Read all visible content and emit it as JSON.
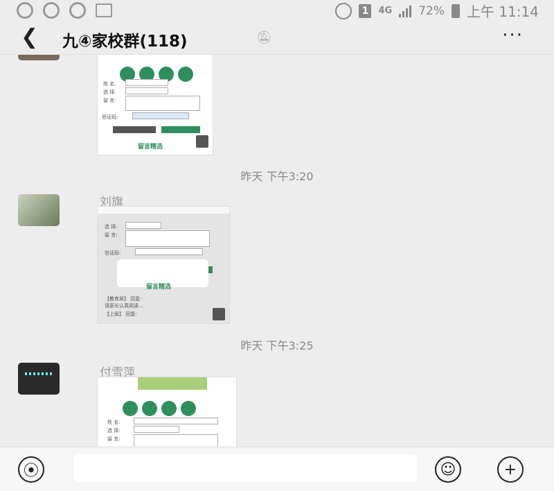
{
  "status": {
    "network": "4G",
    "battery": "72%",
    "time": "上午 11:14",
    "sim": "1"
  },
  "header": {
    "back_icon": "back-arrow-icon",
    "title": "九④家校群(118)",
    "mute_icon": "bell-muted-icon",
    "more_label": "···"
  },
  "messages": [
    {
      "timestamp": "昨天 下午3:20",
      "sender": "刘旗"
    },
    {
      "timestamp": "昨天 下午3:25",
      "sender": "付雪萍"
    }
  ],
  "input": {
    "voice_icon": "voice-icon",
    "emoji_icon": "emoji-icon",
    "plus_icon": "plus-icon"
  },
  "colors": {
    "accent": "#2f8f5c",
    "background": "#ededed"
  }
}
